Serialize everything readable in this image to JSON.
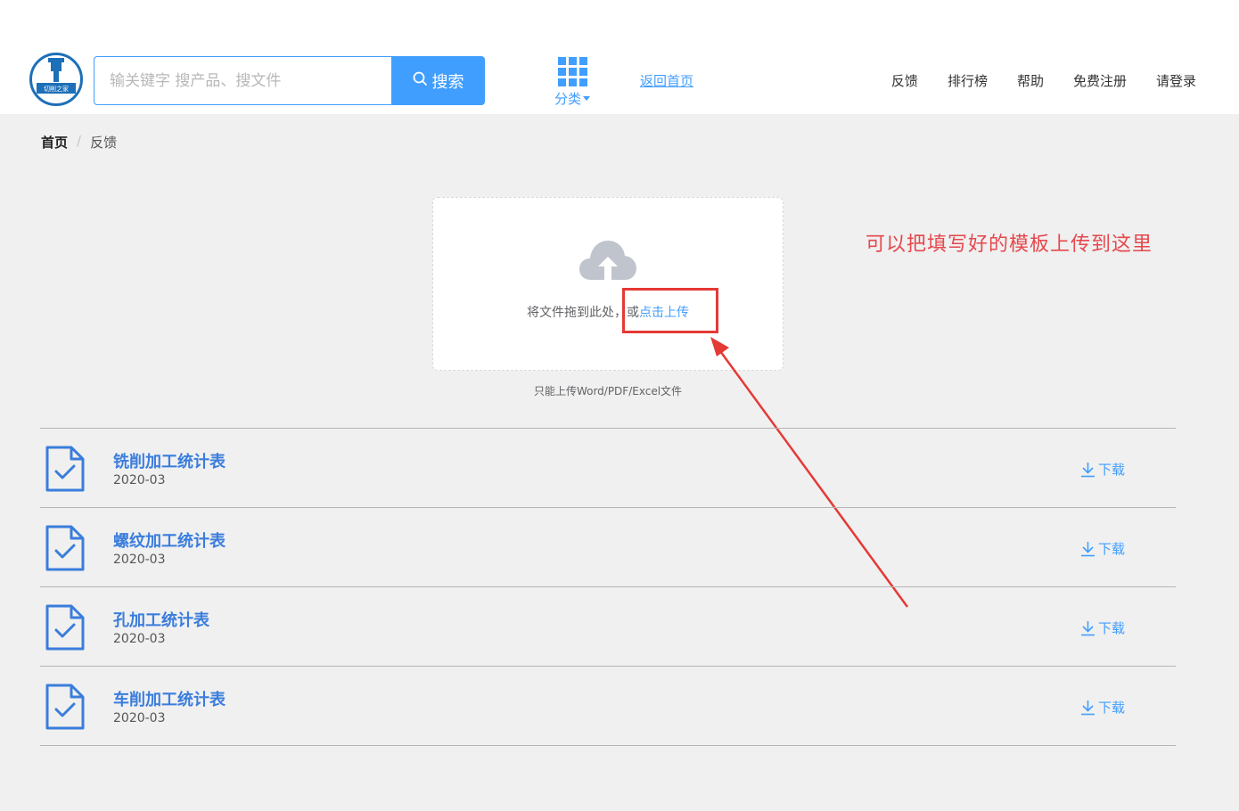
{
  "logo": {
    "text": "切削之家"
  },
  "search": {
    "placeholder": "输关键字 搜产品、搜文件",
    "button_label": "搜索"
  },
  "category": {
    "label": "分类"
  },
  "home_link": "返回首页",
  "nav": [
    "反馈",
    "排行榜",
    "帮助",
    "免费注册",
    "请登录"
  ],
  "breadcrumb": {
    "home": "首页",
    "separator": "/",
    "current": "反馈"
  },
  "upload": {
    "drag_text": "将文件拖到此处，",
    "or_text": "或",
    "click_text": "点击上传",
    "tip": "只能上传Word/PDF/Excel文件"
  },
  "annotation": "可以把填写好的模板上传到这里",
  "files": [
    {
      "name": "铣削加工统计表",
      "date": "2020-03",
      "download": "下载"
    },
    {
      "name": "螺纹加工统计表",
      "date": "2020-03",
      "download": "下载"
    },
    {
      "name": "孔加工统计表",
      "date": "2020-03",
      "download": "下载"
    },
    {
      "name": "车削加工统计表",
      "date": "2020-03",
      "download": "下载"
    }
  ],
  "colors": {
    "primary": "#409eff",
    "annotation": "#e53935",
    "file_title": "#3a7ddc"
  }
}
